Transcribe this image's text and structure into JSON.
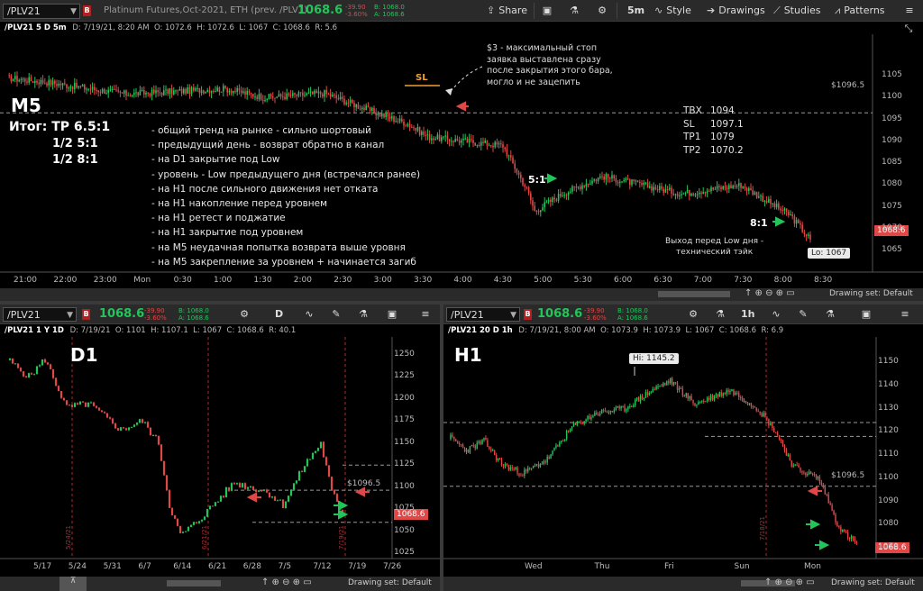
{
  "m5": {
    "toolbar": {
      "symbol": "/PLV21",
      "instrument": "Platinum Futures,Oct-2021, ETH (prev. /PLV1)",
      "last": "1068.6",
      "chg1": "-39.90",
      "chg2": "-3.60%",
      "bid": "B: 1068.0",
      "ask": "A: 1068.6",
      "share": "Share",
      "tf": "5m",
      "style": "Style",
      "drawings": "Drawings",
      "studies": "Studies",
      "patterns": "Patterns"
    },
    "head": {
      "title": "/PLV21 5 D 5m",
      "d": "D: 7/19/21, 8:20 AM",
      "o": "O: 1072.6",
      "h": "H: 1072.6",
      "l": "L: 1067",
      "c": "C: 1068.6",
      "r": "R: 5.6"
    },
    "label": "M5",
    "result": [
      "Итог: TP  6.5:1",
      "1/2  5:1",
      "1/2  8:1"
    ],
    "notes": [
      "- общий тренд на рынке - сильно шортовый",
      "- предыдущий день - возврат обратно в канал",
      "- на D1 закрытие под Low",
      "- уровень - Low предыдущего дня (встречался ранее)",
      "- на H1 после сильного движения нет отката",
      "- на H1 накопление перед уровнем",
      "- на H1 ретест и поджатие",
      "- на H1 закрытие под уровнем",
      "- на M5 неудачная попытка возврата выше уровня",
      "- на M5 закрепление за уровнем + начинается загиб"
    ],
    "stop_note": [
      "$3 - максимальный стоп",
      "заявка выставлена сразу",
      "после закрытия этого бара,",
      "могло и не зацепить"
    ],
    "trade": [
      [
        "TBX",
        "1094"
      ],
      [
        "SL",
        "1097.1"
      ],
      [
        "TP1",
        "1079"
      ],
      [
        "TP2",
        "1070.2"
      ]
    ],
    "sl": "SL",
    "r1": "5:1",
    "r2": "8:1",
    "exit_note": [
      "Выход перед Low дня -",
      "технический тэйк"
    ],
    "lo": "Lo: 1067",
    "level": "$1096.5",
    "last_tag": "1068.6",
    "yticks": [
      "1105",
      "1100",
      "1095",
      "1090",
      "1085",
      "1080",
      "1075",
      "1070",
      "1065"
    ],
    "xticks": [
      "21:00",
      "22:00",
      "23:00",
      "Mon",
      "0:30",
      "1:00",
      "1:30",
      "2:00",
      "2:30",
      "3:00",
      "3:30",
      "4:00",
      "4:30",
      "5:00",
      "5:30",
      "6:00",
      "6:30",
      "7:00",
      "7:30",
      "8:00",
      "8:30"
    ],
    "drawing_set": "Drawing set: Default"
  },
  "d1": {
    "symbol": "/PLV21",
    "last": "1068.6",
    "chg1": "-39.90",
    "chg2": "-3.60%",
    "bid": "B: 1068.0",
    "ask": "A: 1068.6",
    "tf": "D",
    "head": {
      "title": "/PLV21 1 Y 1D",
      "d": "D: 7/19/21",
      "o": "O: 1101",
      "h": "H: 1107.1",
      "l": "L: 1067",
      "c": "C: 1068.6",
      "r": "R: 40.1"
    },
    "label": "D1",
    "level": "$1096.5",
    "last_tag": "1068.6",
    "yticks": [
      "1250",
      "1225",
      "1200",
      "1175",
      "1150",
      "1125",
      "1100",
      "1075",
      "1050",
      "1025"
    ],
    "xticks": [
      "5/17",
      "5/24",
      "5/31",
      "6/7",
      "6/14",
      "6/21",
      "6/28",
      "7/5",
      "7/12",
      "7/19",
      "7/26"
    ],
    "vdates": [
      "5/24/21",
      "6/21/21",
      "7/19/21"
    ],
    "drawing_set": "Drawing set: Default"
  },
  "h1": {
    "symbol": "/PLV21",
    "last": "1068.6",
    "chg1": "-39.90",
    "chg2": "-3.60%",
    "bid": "B: 1068.0",
    "ask": "A: 1068.6",
    "tf": "1h",
    "head": {
      "title": "/PLV21 20 D 1h",
      "d": "D: 7/19/21, 8:00 AM",
      "o": "O: 1073.9",
      "h": "H: 1073.9",
      "l": "L: 1067",
      "c": "C: 1068.6",
      "r": "R: 6.9"
    },
    "label": "H1",
    "hi": "Hi: 1145.2",
    "level": "$1096.5",
    "last_tag": "1068.6",
    "yticks": [
      "1150",
      "1140",
      "1130",
      "1120",
      "1110",
      "1100",
      "1090",
      "1080",
      "1070"
    ],
    "xticks": [
      "Wed",
      "Thu",
      "Fri",
      "Sun",
      "Mon"
    ],
    "vdates": [
      "7/18/21"
    ],
    "drawing_set": "Drawing set: Default"
  },
  "colors": {
    "up": "#23c45a",
    "down": "#e04848",
    "level": "#9a9a9a",
    "bg": "#000000",
    "tag": "#e04848",
    "accent": "#f0a030"
  }
}
